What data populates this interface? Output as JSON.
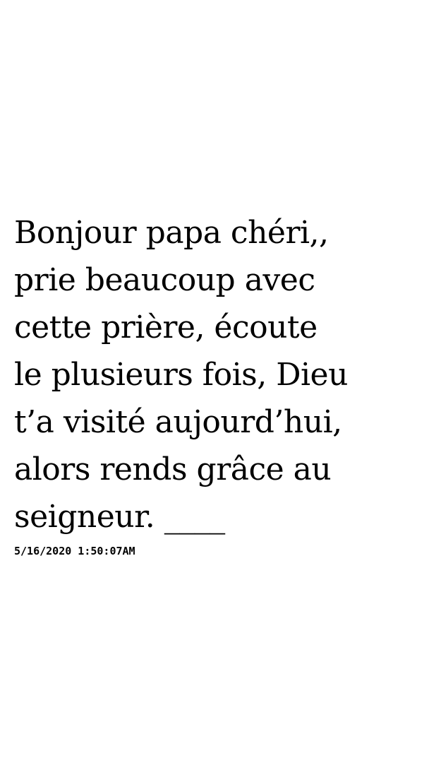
{
  "message": {
    "text": "Bonjour papa chéri,,\nprie beaucoup avec\ncette prière, écoute\nle plusieurs fois, Dieu\nt’a visité aujourd’hui,\nalors rends grâce au\nseigneur. ____",
    "timestamp": "5/16/2020 1:50:07AM"
  },
  "colors": {
    "background": "#ffffff",
    "text": "#000000"
  }
}
